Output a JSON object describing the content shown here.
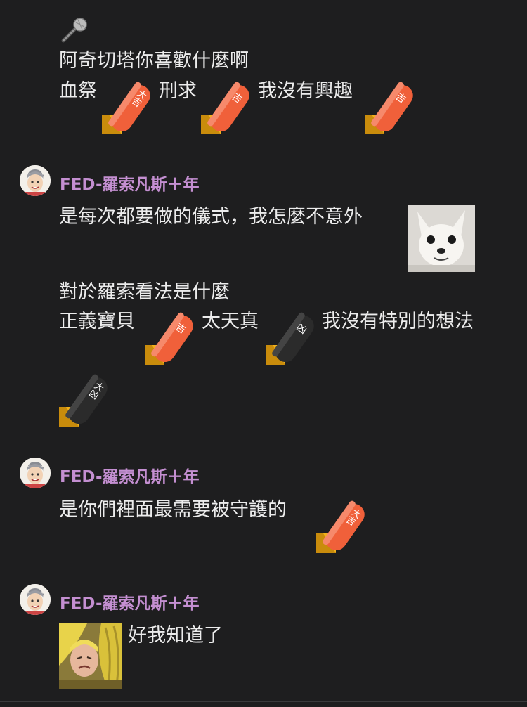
{
  "messages": [
    {
      "lines": [
        "阿奇切塔你喜歡什麼啊"
      ],
      "options": [
        "血祭",
        "刑求",
        "我沒有興趣"
      ]
    },
    {
      "author": "FED-羅索凡斯＋年",
      "line1": "是每次都要做的儀式，我怎麼不意外",
      "line2": "對於羅索看法是什麼",
      "options": [
        "正義寶貝",
        "太天真",
        "我沒有特別的想法"
      ]
    },
    {
      "author": "FED-羅索凡斯＋年",
      "line1": "是你們裡面最需要被守護的"
    },
    {
      "author": "FED-羅索凡斯＋年",
      "line1": "好我知道了"
    }
  ],
  "stick_labels": {
    "daikichi": "大吉",
    "kichi": "吉",
    "kyo": "凶",
    "daikyo": "大凶"
  },
  "colors": {
    "background": "#1e1e1f",
    "author_name": "#c48fd1",
    "stick_good": "#f0603a",
    "stick_bad": "#2a2a2a",
    "stick_base": "#f2b21c"
  },
  "icons": [
    "microphone-icon",
    "omikuji-stick-sticker",
    "chihuahua-sticker",
    "banana-person-sticker"
  ]
}
